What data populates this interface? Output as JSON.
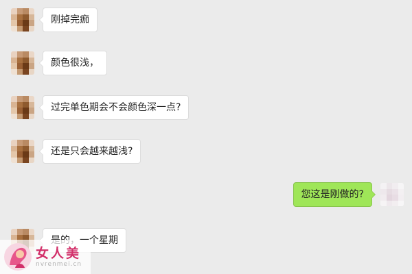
{
  "conversation": {
    "messages": [
      {
        "direction": "in",
        "text": "刚掉完痂"
      },
      {
        "direction": "in",
        "text": "颜色很浅，"
      },
      {
        "direction": "in",
        "text": "过完单色期会不会颜色深一点?"
      },
      {
        "direction": "in",
        "text": "还是只会越来越浅?"
      },
      {
        "direction": "out",
        "text": "您这是刚做的?"
      },
      {
        "direction": "in",
        "text": "是的，一个星期"
      }
    ]
  },
  "watermark": {
    "cn": "女人美",
    "en": "nvrenmei.cn"
  },
  "colors": {
    "background": "#ebebeb",
    "incoming_bubble": "#ffffff",
    "outgoing_bubble": "#9fe658",
    "watermark_brand": "#d2306a"
  }
}
